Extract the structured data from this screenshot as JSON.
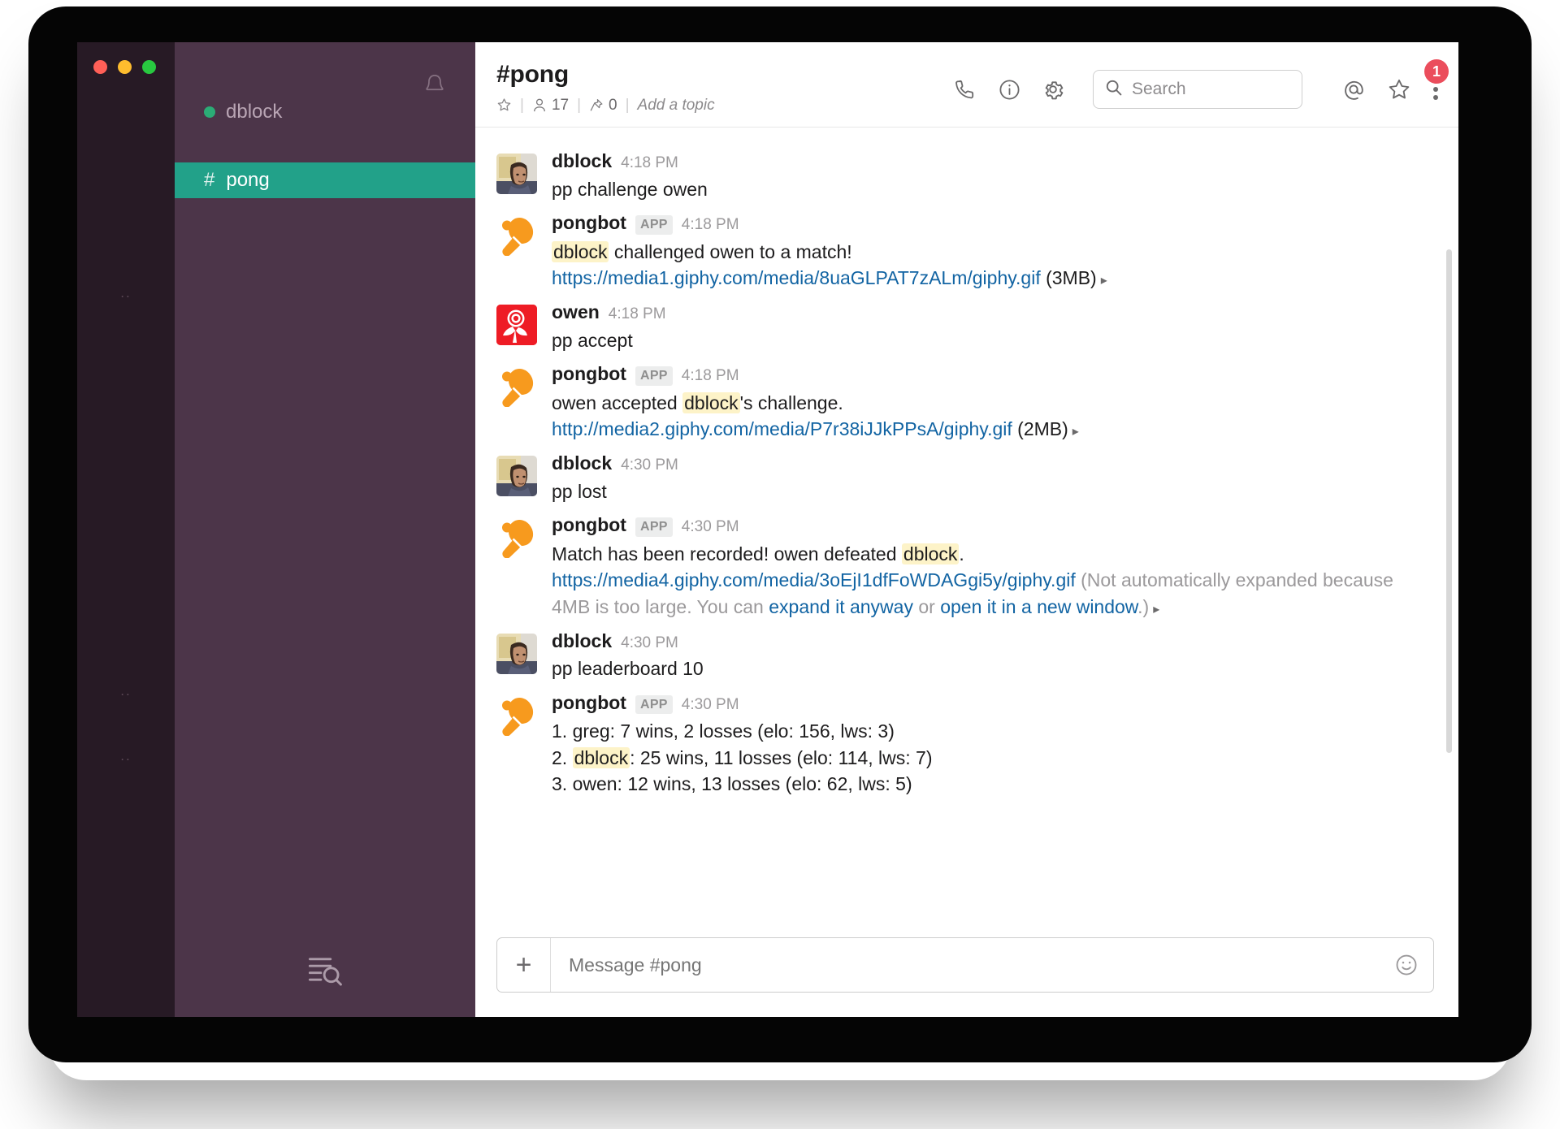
{
  "window": {
    "traffic_lights": [
      "close",
      "minimize",
      "zoom"
    ],
    "colors": {
      "rail_bg": "#271a25",
      "sidebar_bg": "#4c3549",
      "active_channel_bg": "#22a189",
      "accent_link": "#1264a3",
      "mention_highlight": "#fdf3c8",
      "badge_red": "#eb4d5c",
      "presence_green": "#2bac76",
      "bot_orange": "#f79a1e"
    }
  },
  "sidebar": {
    "bell_icon": "bell-icon",
    "team_name": "dblock",
    "presence": "online",
    "channels": [
      {
        "hash": "#",
        "label": "pong",
        "active": true
      }
    ],
    "bottom_icon": "jump-to-icon"
  },
  "header": {
    "channel_title": "#pong",
    "star_icon": "star-outline-icon",
    "members_icon": "person-icon",
    "members_count": "17",
    "pin_icon": "pin-icon",
    "pin_count": "0",
    "add_topic": "Add a topic",
    "separator": "|",
    "actions": [
      {
        "name": "call-icon",
        "glyph": "phone"
      },
      {
        "name": "info-icon",
        "glyph": "info"
      },
      {
        "name": "settings-gear-icon",
        "glyph": "gear"
      }
    ],
    "search": {
      "icon": "search-icon",
      "placeholder": "Search",
      "value": ""
    },
    "right_icons": [
      {
        "name": "mentions-icon",
        "glyph": "@"
      },
      {
        "name": "starred-items-icon",
        "glyph": "star"
      },
      {
        "name": "more-options-icon",
        "glyph": "kebab"
      }
    ],
    "notification_badge": "1"
  },
  "messages": [
    {
      "author": "dblock",
      "avatar": "photo-dblock",
      "is_app": false,
      "time": "4:18 PM",
      "lines": [
        {
          "parts": [
            {
              "t": "text",
              "v": "pp challenge owen"
            }
          ]
        }
      ]
    },
    {
      "author": "pongbot",
      "avatar": "pingpong-paddle",
      "is_app": true,
      "app_label": "APP",
      "time": "4:18 PM",
      "lines": [
        {
          "parts": [
            {
              "t": "mention",
              "v": "dblock"
            },
            {
              "t": "text",
              "v": " challenged owen to a match!"
            }
          ]
        },
        {
          "parts": [
            {
              "t": "link",
              "v": "https://media1.giphy.com/media/8uaGLPAT7zALm/giphy.gif"
            },
            {
              "t": "text",
              "v": " (3MB)"
            },
            {
              "t": "caret",
              "v": "▸"
            }
          ]
        }
      ]
    },
    {
      "author": "owen",
      "avatar": "rose-logo",
      "is_app": false,
      "time": "4:18 PM",
      "lines": [
        {
          "parts": [
            {
              "t": "text",
              "v": "pp accept"
            }
          ]
        }
      ]
    },
    {
      "author": "pongbot",
      "avatar": "pingpong-paddle",
      "is_app": true,
      "app_label": "APP",
      "time": "4:18 PM",
      "lines": [
        {
          "parts": [
            {
              "t": "text",
              "v": "owen accepted "
            },
            {
              "t": "mention",
              "v": "dblock"
            },
            {
              "t": "text",
              "v": "'s challenge."
            }
          ]
        },
        {
          "parts": [
            {
              "t": "link",
              "v": "http://media2.giphy.com/media/P7r38iJJkPPsA/giphy.gif"
            },
            {
              "t": "text",
              "v": " (2MB)"
            },
            {
              "t": "caret",
              "v": "▸"
            }
          ]
        }
      ]
    },
    {
      "author": "dblock",
      "avatar": "photo-dblock",
      "is_app": false,
      "time": "4:30 PM",
      "lines": [
        {
          "parts": [
            {
              "t": "text",
              "v": "pp lost"
            }
          ]
        }
      ]
    },
    {
      "author": "pongbot",
      "avatar": "pingpong-paddle",
      "is_app": true,
      "app_label": "APP",
      "time": "4:30 PM",
      "lines": [
        {
          "parts": [
            {
              "t": "text",
              "v": "Match has been recorded! owen defeated "
            },
            {
              "t": "mention",
              "v": "dblock"
            },
            {
              "t": "text",
              "v": "."
            }
          ]
        },
        {
          "parts": [
            {
              "t": "link",
              "v": "https://media4.giphy.com/media/3oEjI1dfFoWDAGgi5y/giphy.gif"
            },
            {
              "t": "muted",
              "v": " (Not automatically expanded because 4MB is too large. You can "
            },
            {
              "t": "link",
              "v": "expand it anyway"
            },
            {
              "t": "muted",
              "v": " or "
            },
            {
              "t": "link",
              "v": "open it in a new window"
            },
            {
              "t": "muted",
              "v": ".)"
            },
            {
              "t": "caret",
              "v": "▸"
            }
          ]
        }
      ]
    },
    {
      "author": "dblock",
      "avatar": "photo-dblock",
      "is_app": false,
      "time": "4:30 PM",
      "lines": [
        {
          "parts": [
            {
              "t": "text",
              "v": "pp leaderboard 10"
            }
          ]
        }
      ]
    },
    {
      "author": "pongbot",
      "avatar": "pingpong-paddle",
      "is_app": true,
      "app_label": "APP",
      "time": "4:30 PM",
      "lines": [
        {
          "parts": [
            {
              "t": "text",
              "v": "1. greg: 7 wins, 2 losses (elo: 156, lws: 3)"
            }
          ]
        },
        {
          "parts": [
            {
              "t": "text",
              "v": "2. "
            },
            {
              "t": "mention",
              "v": "dblock"
            },
            {
              "t": "text",
              "v": ": 25 wins, 11 losses (elo: 114, lws: 7)"
            }
          ]
        },
        {
          "parts": [
            {
              "t": "text",
              "v": "3. owen: 12 wins, 13 losses (elo: 62, lws: 5)"
            }
          ]
        }
      ]
    }
  ],
  "composer": {
    "plus_icon": "add-attachment-icon",
    "placeholder": "Message #pong",
    "value": "",
    "emoji_icon": "emoji-icon"
  }
}
